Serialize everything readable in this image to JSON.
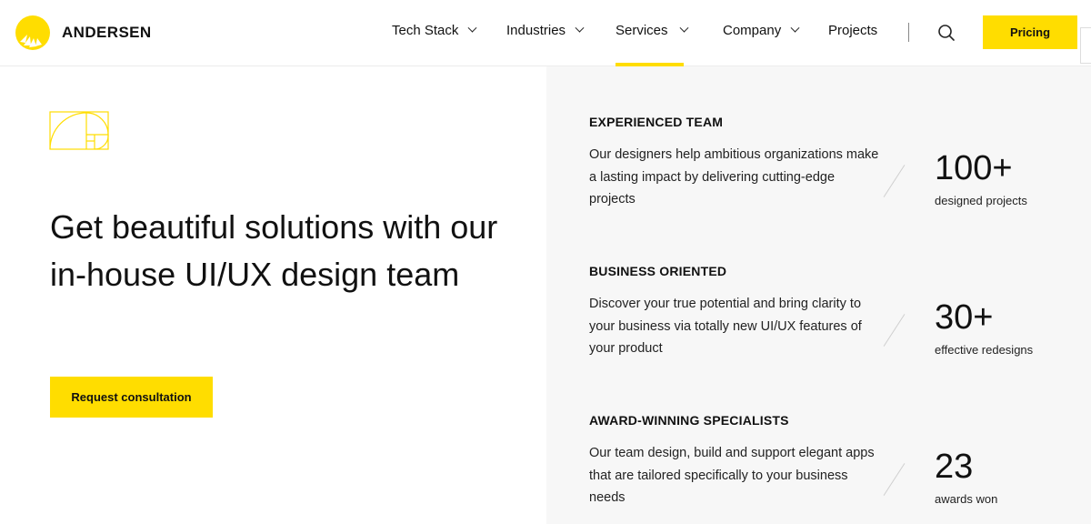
{
  "brand": {
    "name": "ANDERSEN",
    "logo_color": "#ffdd00"
  },
  "nav": {
    "items": [
      {
        "label": "Tech Stack",
        "has_dropdown": true
      },
      {
        "label": "Industries",
        "has_dropdown": true
      },
      {
        "label": "Services",
        "has_dropdown": true,
        "active": true
      },
      {
        "label": "Company",
        "has_dropdown": true
      },
      {
        "label": "Projects",
        "has_dropdown": false
      }
    ],
    "search_icon": "search-icon",
    "pricing_label": "Pricing"
  },
  "hero": {
    "title": "Get beautiful solutions with our in-house UI/UX design team",
    "cta_label": "Request consultation",
    "icon": "golden-ratio-icon"
  },
  "features": [
    {
      "title": "EXPERIENCED TEAM",
      "description": "Our designers help ambitious organizations make a lasting impact by delivering cutting-edge projects",
      "stat_value": "100+",
      "stat_label": "designed projects"
    },
    {
      "title": "BUSINESS ORIENTED",
      "description": "Discover your true potential and bring clarity to your business via totally new UI/UX features of your product",
      "stat_value": "30+",
      "stat_label": "effective redesigns"
    },
    {
      "title": "AWARD-WINNING SPECIALISTS",
      "description": "Our team design, build and support elegant apps that are tailored specifically to your business needs",
      "stat_value": "23",
      "stat_label": "awards won"
    }
  ],
  "colors": {
    "accent": "#ffdd00",
    "panel_bg": "#f7f7f7",
    "text": "#111111"
  }
}
